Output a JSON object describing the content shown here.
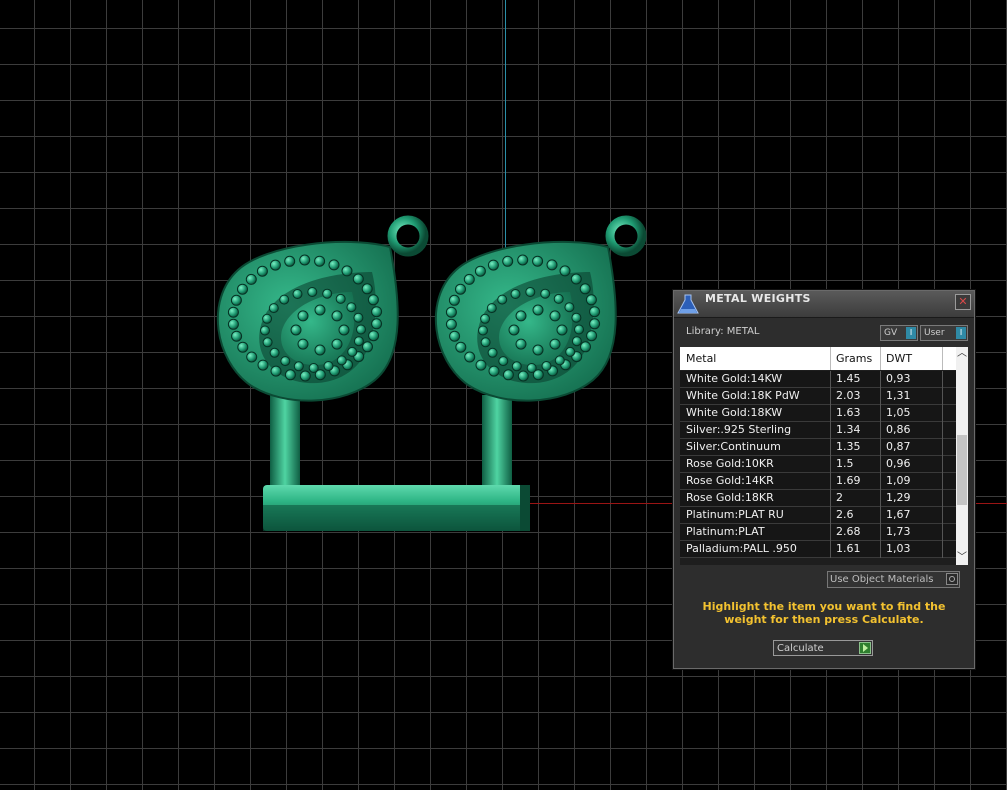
{
  "panel": {
    "title": "METAL WEIGHTS",
    "close_glyph": "✕",
    "library_label": "Library: METAL",
    "toggles": [
      {
        "label": "GV",
        "knob": "I"
      },
      {
        "label": "User",
        "knob": "I"
      }
    ],
    "table": {
      "columns": [
        "Metal",
        "Grams",
        "DWT"
      ],
      "rows": [
        {
          "metal": "White Gold:14KW",
          "grams": "1.45",
          "dwt": "0,93"
        },
        {
          "metal": "White Gold:18K PdW",
          "grams": "2.03",
          "dwt": "1,31"
        },
        {
          "metal": "White Gold:18KW",
          "grams": "1.63",
          "dwt": "1,05"
        },
        {
          "metal": "Silver:.925 Sterling",
          "grams": "1.34",
          "dwt": "0,86"
        },
        {
          "metal": "Silver:Continuum",
          "grams": "1.35",
          "dwt": "0,87"
        },
        {
          "metal": "Rose Gold:10KR",
          "grams": "1.5",
          "dwt": "0,96"
        },
        {
          "metal": "Rose Gold:14KR",
          "grams": "1.69",
          "dwt": "1,09"
        },
        {
          "metal": "Rose Gold:18KR",
          "grams": "2",
          "dwt": "1,29"
        },
        {
          "metal": "Platinum:PLAT RU",
          "grams": "2.6",
          "dwt": "1,67"
        },
        {
          "metal": "Platinum:PLAT",
          "grams": "2.68",
          "dwt": "1,73"
        },
        {
          "metal": "Palladium:PALL .950",
          "grams": "1.61",
          "dwt": "1,03"
        }
      ]
    },
    "use_object_materials_label": "Use Object Materials",
    "hint": "Highlight the item you want to find the weight for then press Calculate.",
    "calculate_label": "Calculate"
  },
  "colors": {
    "model_green": "#1f9a72",
    "hint_yellow": "#f3c230",
    "axis_x": "#9a1414",
    "axis_y": "#2a8fa8"
  },
  "icons": {
    "logo": "flask-logo-icon",
    "close": "close-icon",
    "scroll_up": "chevron-up-icon",
    "scroll_down": "chevron-down-icon",
    "calculate_arrow": "play-arrow-icon"
  }
}
